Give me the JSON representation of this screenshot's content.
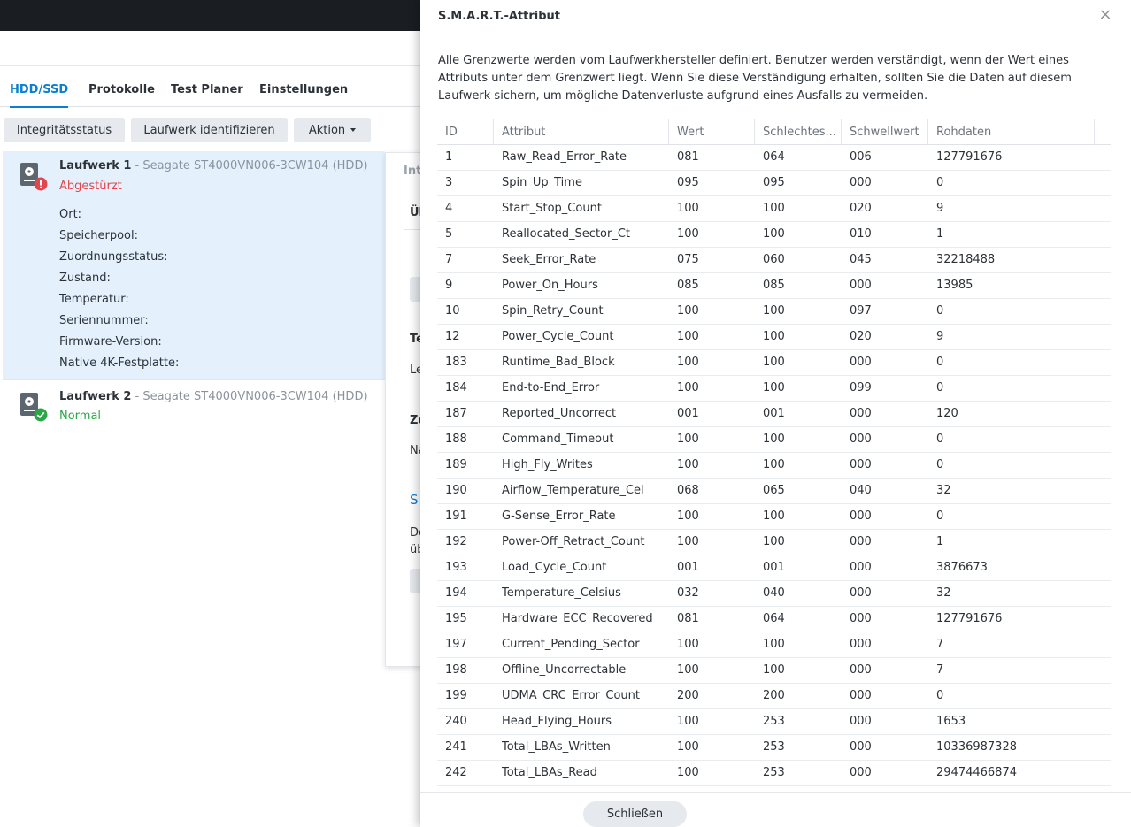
{
  "tabs": [
    "HDD/SSD",
    "Protokolle",
    "Test Planer",
    "Einstellungen"
  ],
  "toolbar": {
    "integrity_label": "Integritätsstatus",
    "identify_label": "Laufwerk identifizieren",
    "action_label": "Aktion"
  },
  "drives": [
    {
      "name": "Laufwerk 1",
      "model": " - Seagate ST4000VN006-3CW104 (HDD)",
      "status": "Abgestürzt",
      "properties": [
        "Ort:",
        "Speicherpool:",
        "Zuordnungsstatus:",
        "Zustand:",
        "Temperatur:",
        "Seriennummer:",
        "Firmware-Version:",
        "Native 4K-Festplatte:"
      ]
    },
    {
      "name": "Laufwerk 2",
      "model": " - Seagate ST4000VN006-3CW104 (HDD)",
      "status": "Normal"
    }
  ],
  "background_panel_fragments": [
    "Int",
    "Ül",
    "Te",
    "Le",
    "Ze",
    "Na",
    "S",
    "De",
    "üb"
  ],
  "dialog": {
    "title": "S.M.A.R.T.-Attribut",
    "description": "Alle Grenzwerte werden vom Laufwerkhersteller definiert. Benutzer werden verständigt, wenn der Wert eines Attributs unter dem Grenzwert liegt. Wenn Sie diese Verständigung erhalten, sollten Sie die Daten auf diesem Laufwerk sichern, um mögliche Datenverluste aufgrund eines Ausfalls zu vermeiden.",
    "columns": [
      "ID",
      "Attribut",
      "Wert",
      "Schlechtes...",
      "Schwellwert",
      "Rohdaten"
    ],
    "rows": [
      [
        "1",
        "Raw_Read_Error_Rate",
        "081",
        "064",
        "006",
        "127791676"
      ],
      [
        "3",
        "Spin_Up_Time",
        "095",
        "095",
        "000",
        "0"
      ],
      [
        "4",
        "Start_Stop_Count",
        "100",
        "100",
        "020",
        "9"
      ],
      [
        "5",
        "Reallocated_Sector_Ct",
        "100",
        "100",
        "010",
        "1"
      ],
      [
        "7",
        "Seek_Error_Rate",
        "075",
        "060",
        "045",
        "32218488"
      ],
      [
        "9",
        "Power_On_Hours",
        "085",
        "085",
        "000",
        "13985"
      ],
      [
        "10",
        "Spin_Retry_Count",
        "100",
        "100",
        "097",
        "0"
      ],
      [
        "12",
        "Power_Cycle_Count",
        "100",
        "100",
        "020",
        "9"
      ],
      [
        "183",
        "Runtime_Bad_Block",
        "100",
        "100",
        "000",
        "0"
      ],
      [
        "184",
        "End-to-End_Error",
        "100",
        "100",
        "099",
        "0"
      ],
      [
        "187",
        "Reported_Uncorrect",
        "001",
        "001",
        "000",
        "120"
      ],
      [
        "188",
        "Command_Timeout",
        "100",
        "100",
        "000",
        "0"
      ],
      [
        "189",
        "High_Fly_Writes",
        "100",
        "100",
        "000",
        "0"
      ],
      [
        "190",
        "Airflow_Temperature_Cel",
        "068",
        "065",
        "040",
        "32"
      ],
      [
        "191",
        "G-Sense_Error_Rate",
        "100",
        "100",
        "000",
        "0"
      ],
      [
        "192",
        "Power-Off_Retract_Count",
        "100",
        "100",
        "000",
        "1"
      ],
      [
        "193",
        "Load_Cycle_Count",
        "001",
        "001",
        "000",
        "3876673"
      ],
      [
        "194",
        "Temperature_Celsius",
        "032",
        "040",
        "000",
        "32"
      ],
      [
        "195",
        "Hardware_ECC_Recovered",
        "081",
        "064",
        "000",
        "127791676"
      ],
      [
        "197",
        "Current_Pending_Sector",
        "100",
        "100",
        "000",
        "7"
      ],
      [
        "198",
        "Offline_Uncorrectable",
        "100",
        "100",
        "000",
        "7"
      ],
      [
        "199",
        "UDMA_CRC_Error_Count",
        "200",
        "200",
        "000",
        "0"
      ],
      [
        "240",
        "Head_Flying_Hours",
        "100",
        "253",
        "000",
        "1653"
      ],
      [
        "241",
        "Total_LBAs_Written",
        "100",
        "253",
        "000",
        "10336987328"
      ],
      [
        "242",
        "Total_LBAs_Read",
        "100",
        "253",
        "000",
        "29474466874"
      ]
    ],
    "close_label": "Schließen"
  },
  "colors": {
    "accent": "#0a7fd0",
    "error": "#e0464c",
    "ok": "#2aa845",
    "selected_bg": "#e4f1fc"
  },
  "icons": [
    "hdd-icon",
    "error-badge-icon",
    "ok-badge-icon",
    "close-icon",
    "chevron-down-icon"
  ]
}
